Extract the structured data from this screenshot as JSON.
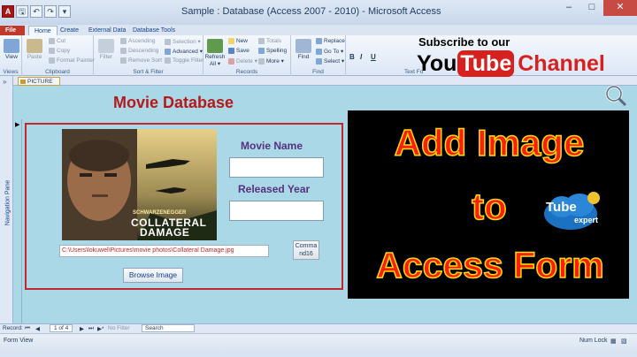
{
  "window": {
    "title": "Sample : Database (Access 2007 - 2010) - Microsoft Access",
    "app_icon": "A",
    "buttons": [
      "–",
      "□",
      "✕"
    ]
  },
  "tabs": [
    "File",
    "Home",
    "Create",
    "External Data",
    "Database Tools"
  ],
  "ribbon": {
    "views": {
      "label": "Views",
      "view": "View"
    },
    "clipboard": {
      "label": "Clipboard",
      "paste": "Paste",
      "cut": "Cut",
      "copy": "Copy",
      "format_painter": "Format Painter"
    },
    "sort_filter": {
      "label": "Sort & Filter",
      "filter": "Filter",
      "ascending": "Ascending",
      "descending": "Descending",
      "remove_sort": "Remove Sort",
      "selection": "Selection ▾",
      "advanced": "Advanced ▾",
      "toggle_filter": "Toggle Filter"
    },
    "records": {
      "label": "Records",
      "refresh": "Refresh",
      "refresh_sub": "All ▾",
      "new": "New",
      "save": "Save",
      "delete": "Delete ▾",
      "totals": "Totals",
      "spelling": "Spelling",
      "more": "More ▾"
    },
    "find": {
      "label": "Find",
      "find": "Find",
      "replace": "Replace",
      "goto": "Go To ▾",
      "select": "Select ▾"
    },
    "text_formatting": {
      "label": "Text Fo",
      "bold": "B",
      "italic": "I",
      "underline": "U"
    }
  },
  "nav_pane": {
    "label": "Navigation Pane",
    "chevron": "»"
  },
  "document_tab": {
    "label": "PICTURE"
  },
  "form": {
    "title": "Movie Database",
    "movie_name_label": "Movie Name",
    "released_year_label": "Released Year",
    "movie_name_value": "",
    "released_year_value": "",
    "image_path": "C:\\Users\\lokuwel\\Pictures\\movie photos\\Collateral Damage.jpg",
    "command_button": "Comma nd16",
    "browse_button": "Browse Image",
    "poster": {
      "line1": "SCHWARZENEGGER",
      "line2": "COLLATERAL",
      "line3": "DAMAGE"
    }
  },
  "overlay": {
    "line1": "Add Image",
    "line2": "to",
    "line3": "Access Form",
    "subscribe": "Subscribe to our",
    "you": "You",
    "tube": "Tube",
    "channel": "Channel",
    "badge_tube": "Tube",
    "badge_expert": "expert"
  },
  "record_nav": {
    "record_label": "Record:",
    "position": "1 of 4",
    "no_filter": "No Filter",
    "search": "Search"
  },
  "status": {
    "left": "Form View",
    "numlock": "Num Lock"
  },
  "colors": {
    "title_red": "#b4191c",
    "form_bg": "#abd8e6",
    "label_purple": "#553080",
    "promo_red": "#fa1e0e",
    "promo_yellow": "#ffdd00"
  }
}
